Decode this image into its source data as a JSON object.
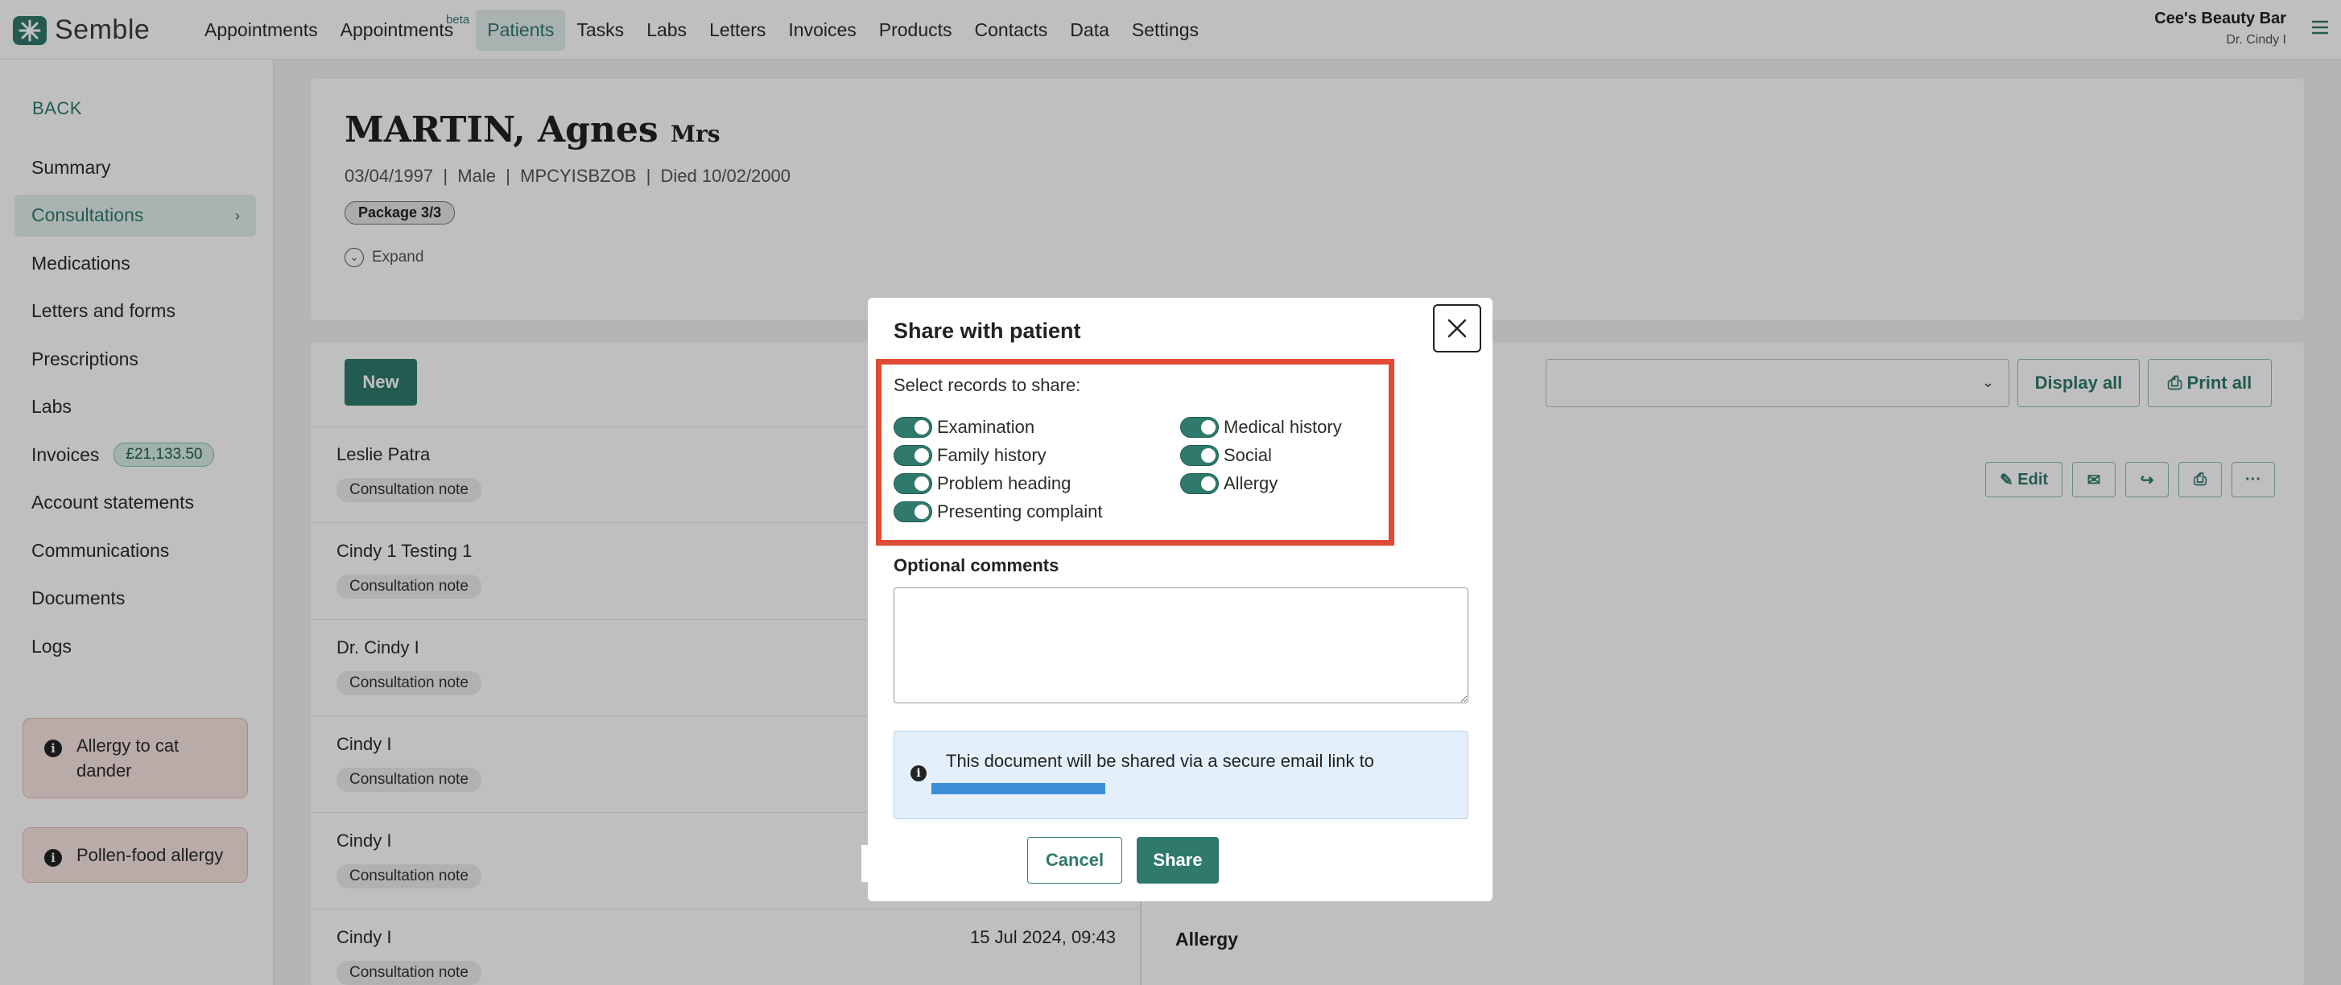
{
  "app": {
    "brand": "Semble",
    "accent": "#2f7a6d"
  },
  "nav": {
    "items": [
      {
        "label": "Appointments",
        "beta": ""
      },
      {
        "label": "Appointments",
        "beta": "beta"
      },
      {
        "label": "Patients",
        "beta": ""
      },
      {
        "label": "Tasks",
        "beta": ""
      },
      {
        "label": "Labs",
        "beta": ""
      },
      {
        "label": "Letters",
        "beta": ""
      },
      {
        "label": "Invoices",
        "beta": ""
      },
      {
        "label": "Products",
        "beta": ""
      },
      {
        "label": "Contacts",
        "beta": ""
      },
      {
        "label": "Data",
        "beta": ""
      },
      {
        "label": "Settings",
        "beta": ""
      }
    ],
    "org_name": "Cee's Beauty Bar",
    "org_user": "Dr. Cindy I"
  },
  "sidebar": {
    "back_label": "BACK",
    "items": [
      {
        "label": "Summary"
      },
      {
        "label": "Consultations"
      },
      {
        "label": "Medications"
      },
      {
        "label": "Letters and forms"
      },
      {
        "label": "Prescriptions"
      },
      {
        "label": "Labs"
      },
      {
        "label": "Invoices"
      },
      {
        "label": "Account statements"
      },
      {
        "label": "Communications"
      },
      {
        "label": "Documents"
      },
      {
        "label": "Logs"
      }
    ],
    "invoice_balance": "£21,133.50",
    "alerts": [
      "Allergy to cat dander",
      "Pollen-food allergy"
    ]
  },
  "patient": {
    "surname": "MARTIN,",
    "firstname": "Agnes",
    "title": "Mrs",
    "meta": "03/04/1997  |  Male  |  MPCYISBZOB  |  Died 10/02/2000",
    "package": "Package 3/3",
    "expand_label": "Expand"
  },
  "records": {
    "new_label": "New",
    "display_all_label": "Display all",
    "print_all_label": "Print all",
    "edit_label": "Edit",
    "consultations": [
      {
        "who": "Leslie Patra",
        "tag": "Consultation note",
        "when": ""
      },
      {
        "who": "Cindy 1 Testing 1",
        "tag": "Consultation note",
        "when": ""
      },
      {
        "who": "Dr. Cindy I",
        "tag": "Consultation note",
        "when": ""
      },
      {
        "who": "Cindy I",
        "tag": "Consultation note",
        "when": ""
      },
      {
        "who": "Cindy I",
        "tag": "Consultation note",
        "when": ""
      },
      {
        "who": "Cindy I",
        "tag": "Consultation note",
        "when": "15 Jul 2024, 09:43"
      }
    ],
    "detail_heading": "Allergy"
  },
  "modal": {
    "title": "Share with patient",
    "select_label": "Select records to share:",
    "toggles_left": [
      "Examination",
      "Family history",
      "Problem heading",
      "Presenting complaint"
    ],
    "toggles_right": [
      "Medical history",
      "Social",
      "Allergy"
    ],
    "optional_label": "Optional comments",
    "info_text": "This document will be shared via a secure email link to",
    "cancel_label": "Cancel",
    "share_label": "Share",
    "highlight_color": "#e04b35"
  }
}
